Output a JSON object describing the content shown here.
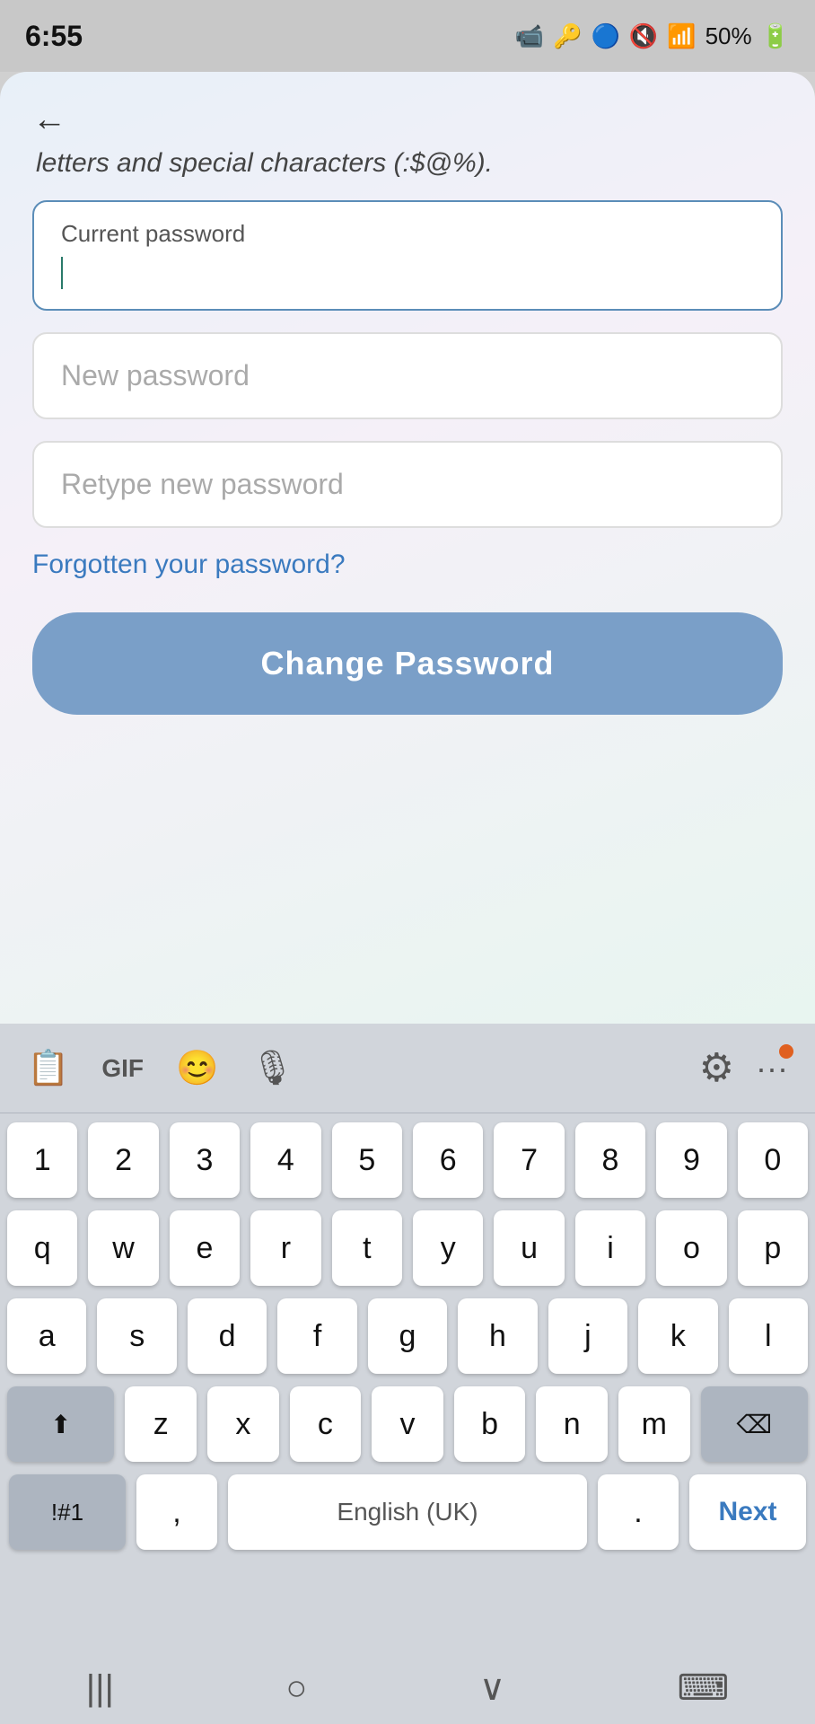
{
  "statusBar": {
    "time": "6:55",
    "battery": "50%",
    "icons": [
      "📹",
      "🔑",
      "🔑",
      "🔵",
      "🔇",
      "📶",
      "50%",
      "🔋"
    ]
  },
  "appHeader": {
    "hintText": "letters and special characters (:$@%).",
    "backLabel": "←"
  },
  "form": {
    "currentPasswordLabel": "Current password",
    "currentPasswordPlaceholder": "",
    "newPasswordPlaceholder": "New password",
    "retypePasswordPlaceholder": "Retype new password",
    "forgottenLink": "Forgotten your password?",
    "changePasswordButton": "Change Password"
  },
  "keyboard": {
    "row1": [
      "1",
      "2",
      "3",
      "4",
      "5",
      "6",
      "7",
      "8",
      "9",
      "0"
    ],
    "row2": [
      "q",
      "w",
      "e",
      "r",
      "t",
      "y",
      "u",
      "i",
      "o",
      "p"
    ],
    "row3": [
      "a",
      "s",
      "d",
      "f",
      "g",
      "h",
      "j",
      "k",
      "l"
    ],
    "row4": [
      "z",
      "x",
      "c",
      "v",
      "b",
      "n",
      "m"
    ],
    "shiftLabel": "⬆",
    "backspaceLabel": "⌫",
    "symbolsLabel": "!#1",
    "commaLabel": ",",
    "spaceLabel": "English (UK)",
    "periodLabel": ".",
    "nextLabel": "Next"
  },
  "navbar": {
    "backLabel": "|||",
    "homeLabel": "○",
    "recentsLabel": "∨",
    "keyboardLabel": "⌨"
  }
}
